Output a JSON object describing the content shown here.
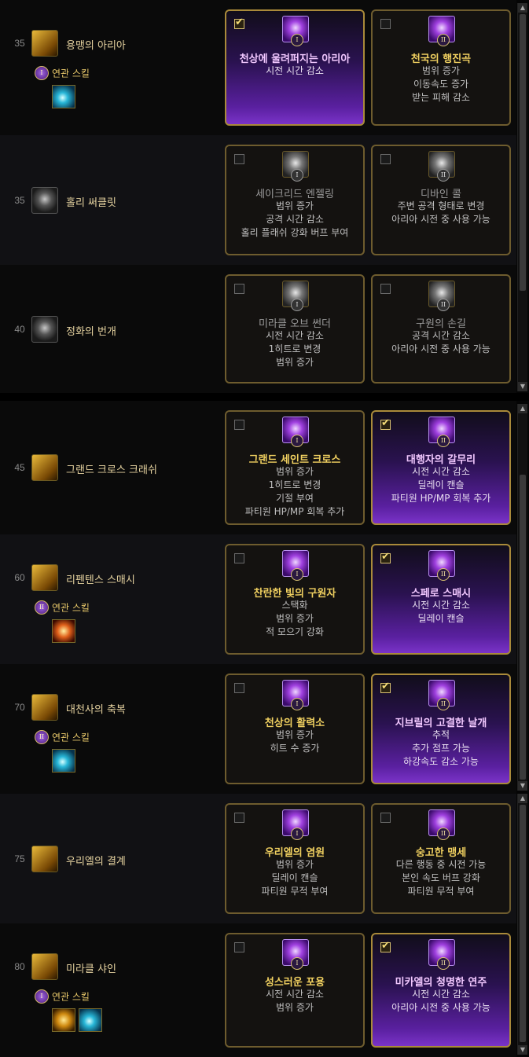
{
  "panel1": {
    "rows": [
      {
        "level": "35",
        "skill": "용맹의 아리아",
        "icon": "aria-icon",
        "related": {
          "badge": "I",
          "label": "연관 스킬",
          "icons": [
            "cyan"
          ]
        },
        "choices": [
          {
            "roman": "I",
            "title": "천상에 울려퍼지는 아리아",
            "selected": true,
            "effects": [
              "시전 시간 감소"
            ]
          },
          {
            "roman": "II",
            "title": "천국의 행진곡",
            "selected": false,
            "effects": [
              "범위 증가",
              "이동속도 증가",
              "받는 피해 감소"
            ]
          }
        ]
      },
      {
        "level": "35",
        "skill": "홀리 써클릿",
        "icon": "circlet-icon",
        "locked": true,
        "choices": [
          {
            "roman": "I",
            "title": "세이크리드 엔젤링",
            "selected": false,
            "effects": [
              "범위 증가",
              "공격 시간 감소",
              "홀리 플래쉬 강화 버프 부여"
            ]
          },
          {
            "roman": "II",
            "title": "디바인 콜",
            "selected": false,
            "effects": [
              "주변 공격 형태로 변경",
              "아리아 시전 중 사용 가능"
            ]
          }
        ]
      },
      {
        "level": "40",
        "skill": "정화의 번개",
        "icon": "lightning-icon",
        "locked": true,
        "choices": [
          {
            "roman": "I",
            "title": "미라클 오브 썬더",
            "selected": false,
            "effects": [
              "시전 시간 감소",
              "1히트로 변경",
              "범위 증가"
            ]
          },
          {
            "roman": "II",
            "title": "구원의 손길",
            "selected": false,
            "effects": [
              "공격 시간 감소",
              "아리아 시전 중 사용 가능"
            ]
          }
        ]
      }
    ]
  },
  "panel2": {
    "rows": [
      {
        "level": "45",
        "skill": "그랜드 크로스 크래쉬",
        "icon": "grand-cross-icon",
        "choices": [
          {
            "roman": "I",
            "title": "그랜드 세인트 크로스",
            "selected": false,
            "effects": [
              "범위 증가",
              "1히트로 변경",
              "기절 부여",
              "파티원 HP/MP 회복 추가"
            ]
          },
          {
            "roman": "II",
            "title": "대행자의 갈무리",
            "selected": true,
            "effects": [
              "시전 시간 감소",
              "딜레이 캔슬",
              "파티원 HP/MP 회복 추가"
            ]
          }
        ]
      },
      {
        "level": "60",
        "skill": "리펜텐스 스매시",
        "icon": "repentance-icon",
        "related": {
          "badge": "II",
          "label": "연관 스킬",
          "icons": [
            "orange"
          ]
        },
        "choices": [
          {
            "roman": "I",
            "title": "찬란한 빛의 구원자",
            "selected": false,
            "effects": [
              "스택화",
              "범위 증가",
              "적 모으기 강화"
            ]
          },
          {
            "roman": "II",
            "title": "스페로 스매시",
            "selected": true,
            "effects": [
              "시전 시간 감소",
              "딜레이 캔슬"
            ]
          }
        ]
      },
      {
        "level": "70",
        "skill": "대천사의 축복",
        "icon": "archangel-icon",
        "related": {
          "badge": "II",
          "label": "연관 스킬",
          "icons": [
            "cyan"
          ]
        },
        "choices": [
          {
            "roman": "I",
            "title": "천상의 활력소",
            "selected": false,
            "effects": [
              "범위 증가",
              "히트 수 증가"
            ]
          },
          {
            "roman": "II",
            "title": "지브릴의 고결한 날개",
            "selected": true,
            "effects": [
              "추적",
              "추가 점프 가능",
              "하강속도 감소 가능"
            ]
          }
        ]
      },
      {
        "level": "75",
        "skill": "우리엘의 결계",
        "icon": "uriel-icon",
        "choices": [
          {
            "roman": "I",
            "title": "우리엘의 염원",
            "selected": false,
            "effects": [
              "범위 증가",
              "딜레이 캔슬",
              "파티원 무적 부여"
            ]
          },
          {
            "roman": "II",
            "title": "숭고한 맹세",
            "selected": false,
            "effects": [
              "다른 행동 중 시전 가능",
              "본인 속도 버프 강화",
              "파티원 무적 부여"
            ]
          }
        ]
      },
      {
        "level": "80",
        "skill": "미라클 샤인",
        "icon": "miracle-shine-icon",
        "related": {
          "badge": "I",
          "label": "연관 스킬",
          "icons": [
            "gold",
            "cyan"
          ]
        },
        "choices": [
          {
            "roman": "I",
            "title": "성스러운 포용",
            "selected": false,
            "effects": [
              "시전 시간 감소",
              "범위 증가"
            ]
          },
          {
            "roman": "II",
            "title": "미카엘의 청명한 연주",
            "selected": true,
            "effects": [
              "시전 시간 감소",
              "아리아 시전 중 사용 가능"
            ]
          }
        ]
      }
    ]
  }
}
